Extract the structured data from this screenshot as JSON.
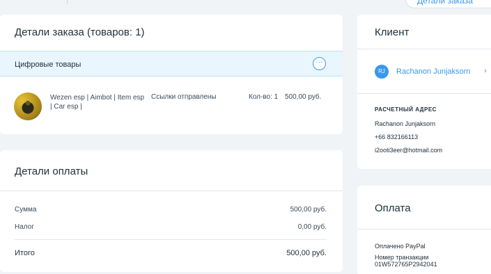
{
  "top_button": "Детали заказа",
  "order": {
    "title": "Детали заказа (товаров: 1)",
    "section_label": "Цифровые товары",
    "more_glyph": "···",
    "item": {
      "name": "Wezen esp | Aimbot | Item esp | Car esp |",
      "status": "Ссылки отправлены",
      "qty": "Кол-во: 1",
      "price": "500,00 руб."
    }
  },
  "payment": {
    "title": "Детали оплаты",
    "rows": [
      {
        "label": "Сумма",
        "value": "500,00 руб."
      },
      {
        "label": "Налог",
        "value": "0,00 руб."
      }
    ],
    "total": {
      "label": "Итого",
      "value": "500,00 руб."
    }
  },
  "client": {
    "title": "Клиент",
    "initials": "RJ",
    "name": "Rachanon Junjaksorn",
    "chevron": "›",
    "address_title": "РАСЧЕТНЫЙ АДРЕС",
    "address_lines": [
      "Rachanon Junjaksorn",
      "+66 832166113",
      "i2ooti3eer@hotmail.com"
    ]
  },
  "payment_side": {
    "title": "Оплата",
    "paid_via": "Оплачено PayPal",
    "transaction_label": "Номер транзакции",
    "transaction_id": "01W572765P2942041"
  },
  "colors": {
    "accent": "#3899ec",
    "background": "#f0f4f7",
    "section_bar": "#eaf6fe"
  }
}
